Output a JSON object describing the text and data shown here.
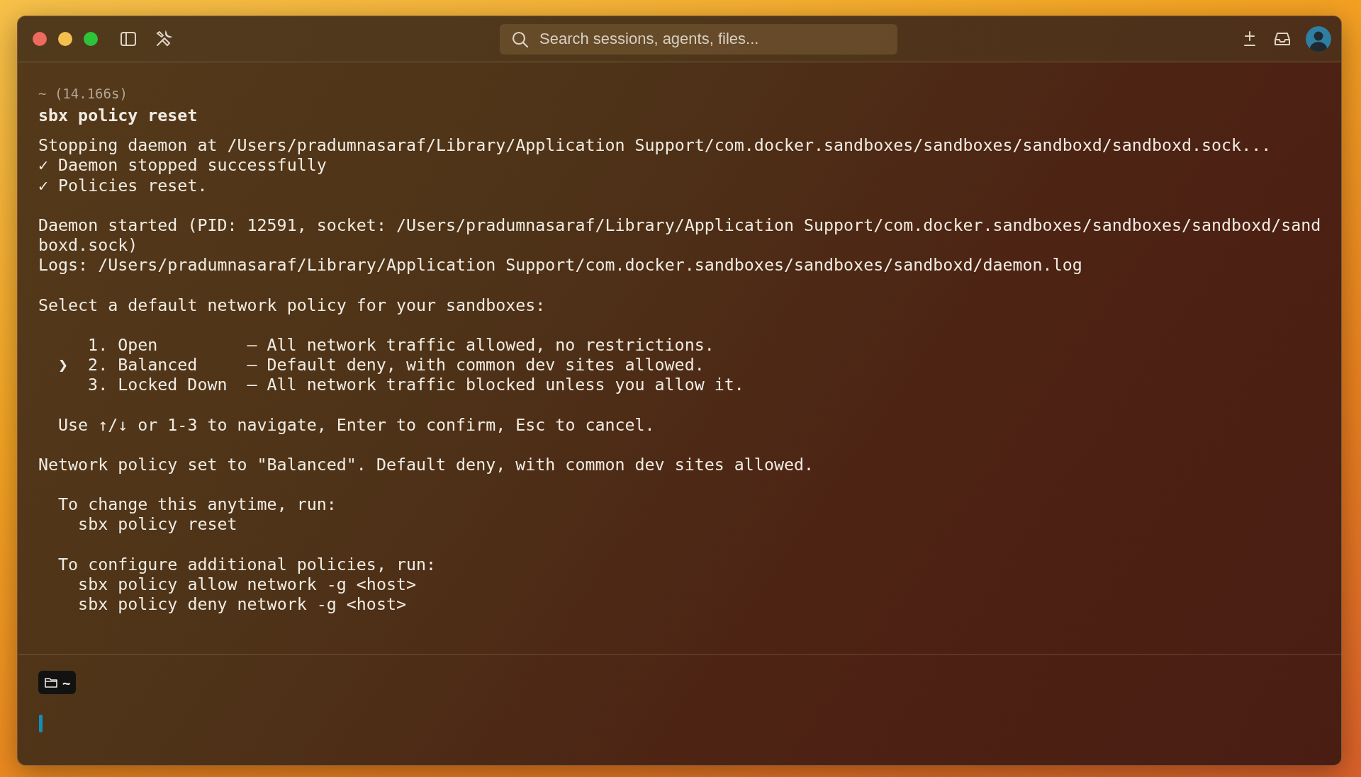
{
  "window": {
    "search": {
      "placeholder": "Search sessions, agents, files..."
    }
  },
  "terminal": {
    "duration": "~ (14.166s)",
    "command": "sbx policy reset",
    "blocks": [
      {
        "kind": "lines",
        "lines": [
          "Stopping daemon at /Users/pradumnasaraf/Library/Application Support/com.docker.sandboxes/sandboxes/sandboxd/sandboxd.sock...",
          "✓ Daemon stopped successfully",
          "✓ Policies reset."
        ]
      },
      {
        "kind": "lines",
        "lines": [
          "Daemon started (PID: 12591, socket: /Users/pradumnasaraf/Library/Application Support/com.docker.sandboxes/sandboxes/sandboxd/sandboxd.sock)",
          "Logs: /Users/pradumnasaraf/Library/Application Support/com.docker.sandboxes/sandboxes/sandboxd/daemon.log"
        ]
      },
      {
        "kind": "lines",
        "lines": [
          "Select a default network policy for your sandboxes:"
        ]
      },
      {
        "kind": "menu",
        "pointer": "❯",
        "options": [
          {
            "number": "1.",
            "label": "Open",
            "description": "— All network traffic allowed, no restrictions.",
            "selected": false
          },
          {
            "number": "2.",
            "label": "Balanced",
            "description": "— Default deny, with common dev sites allowed.",
            "selected": true
          },
          {
            "number": "3.",
            "label": "Locked Down",
            "description": "— All network traffic blocked unless you allow it.",
            "selected": false
          }
        ]
      },
      {
        "kind": "lines",
        "lines": [
          "  Use ↑/↓ or 1-3 to navigate, Enter to confirm, Esc to cancel."
        ]
      },
      {
        "kind": "lines",
        "lines": [
          "Network policy set to \"Balanced\". Default deny, with common dev sites allowed."
        ]
      },
      {
        "kind": "lines",
        "lines": [
          "  To change this anytime, run:",
          "    sbx policy reset"
        ]
      },
      {
        "kind": "lines",
        "lines": [
          "  To configure additional policies, run:",
          "    sbx policy allow network -g <host>",
          "    sbx policy deny network -g <host>"
        ]
      }
    ]
  },
  "input": {
    "directory": "~"
  }
}
